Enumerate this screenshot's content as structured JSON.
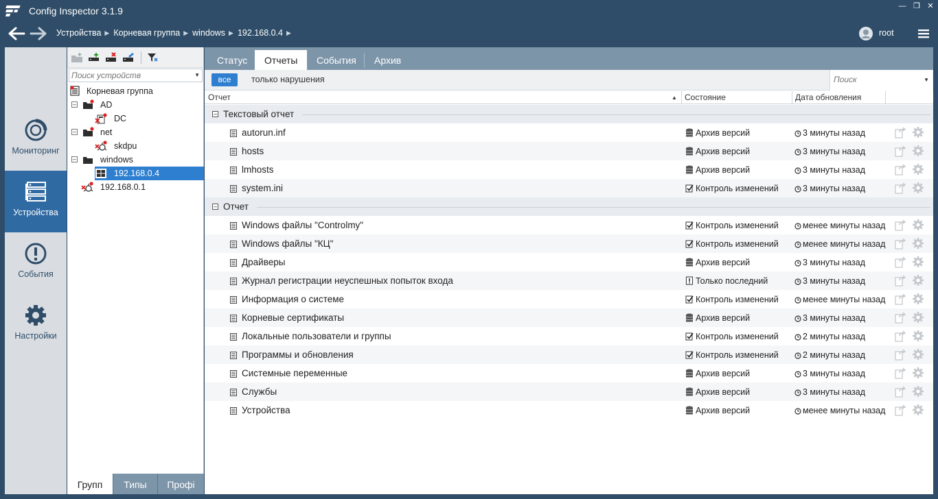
{
  "app": {
    "title": "Config Inspector 3.1.9"
  },
  "breadcrumb": [
    "Устройства",
    "Корневая группа",
    "windows",
    "192.168.0.4"
  ],
  "user": {
    "name": "root"
  },
  "rail": [
    {
      "label": "Мониторинг",
      "icon": "monitoring-icon"
    },
    {
      "label": "Устройства",
      "icon": "devices-icon"
    },
    {
      "label": "События",
      "icon": "events-icon"
    },
    {
      "label": "Настройки",
      "icon": "settings-icon"
    }
  ],
  "tree": {
    "search_placeholder": "Поиск устройств",
    "items": [
      {
        "label": "Корневая группа",
        "icon": "root-group-icon"
      },
      {
        "label": "AD",
        "icon": "folder-icon"
      },
      {
        "label": "DC",
        "icon": "server-error-icon"
      },
      {
        "label": "net",
        "icon": "folder-icon"
      },
      {
        "label": "skdpu",
        "icon": "network-error-icon"
      },
      {
        "label": "windows",
        "icon": "folder-icon"
      },
      {
        "label": "192.168.0.4",
        "icon": "windows-icon"
      },
      {
        "label": "192.168.0.1",
        "icon": "network-error-icon"
      }
    ],
    "tabs": [
      "Групп",
      "Типы",
      "Профі"
    ]
  },
  "tabs": [
    "Статус",
    "Отчеты",
    "События",
    "Архив"
  ],
  "filters": {
    "all": "все",
    "violations": "только нарушения",
    "search_placeholder": "Поиск"
  },
  "columns": {
    "report": "Отчет",
    "state": "Состояние",
    "updated": "Дата обновления"
  },
  "groups": [
    {
      "label": "Текстовый отчет",
      "rows": [
        {
          "name": "autorun.inf",
          "state": "Архив версий",
          "state_icon": "archive-icon",
          "updated": "3 минуты назад"
        },
        {
          "name": "hosts",
          "state": "Архив версий",
          "state_icon": "archive-icon",
          "updated": "3 минуты назад"
        },
        {
          "name": "lmhosts",
          "state": "Архив версий",
          "state_icon": "archive-icon",
          "updated": "3 минуты назад"
        },
        {
          "name": "system.ini",
          "state": "Контроль изменений",
          "state_icon": "check-icon",
          "updated": "3 минуты назад"
        }
      ]
    },
    {
      "label": "Отчет",
      "rows": [
        {
          "name": "Windows файлы \"Controlmy\"",
          "state": "Контроль изменений",
          "state_icon": "check-icon",
          "updated": "менее минуты назад"
        },
        {
          "name": "Windows файлы \"КЦ\"",
          "state": "Контроль изменений",
          "state_icon": "check-icon",
          "updated": "менее минуты назад"
        },
        {
          "name": "Драйверы",
          "state": "Архив версий",
          "state_icon": "archive-icon",
          "updated": "3 минуты назад"
        },
        {
          "name": "Журнал регистрации неуспешных попыток входа",
          "state": "Только последний",
          "state_icon": "last-only-icon",
          "updated": "3 минуты назад"
        },
        {
          "name": "Информация о системе",
          "state": "Контроль изменений",
          "state_icon": "check-icon",
          "updated": "менее минуты назад"
        },
        {
          "name": "Корневые сертификаты",
          "state": "Архив версий",
          "state_icon": "archive-icon",
          "updated": "3 минуты назад"
        },
        {
          "name": "Локальные пользователи и группы",
          "state": "Контроль изменений",
          "state_icon": "check-icon",
          "updated": "2 минуты назад"
        },
        {
          "name": "Программы и обновления",
          "state": "Контроль изменений",
          "state_icon": "check-icon",
          "updated": "2 минуты назад"
        },
        {
          "name": "Системные переменные",
          "state": "Архив версий",
          "state_icon": "archive-icon",
          "updated": "3 минуты назад"
        },
        {
          "name": "Службы",
          "state": "Архив версий",
          "state_icon": "archive-icon",
          "updated": "3 минуты назад"
        },
        {
          "name": "Устройства",
          "state": "Архив версий",
          "state_icon": "archive-icon",
          "updated": "менее минуты назад"
        }
      ]
    }
  ]
}
